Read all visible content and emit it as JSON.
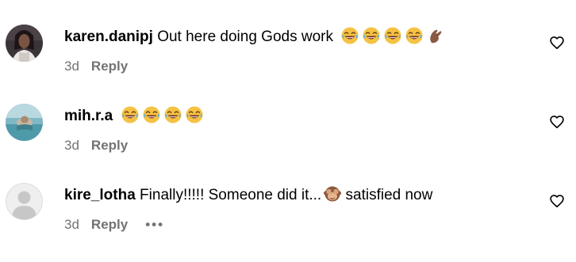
{
  "comments": [
    {
      "username": "karen.danipj",
      "text": "Out here doing Gods work",
      "emojis": [
        "joy-emoji",
        "joy-emoji",
        "joy-emoji",
        "joy-emoji",
        "pinching-hand-emoji"
      ],
      "time": "3d",
      "reply_label": "Reply"
    },
    {
      "username": "mih.r.a",
      "text": "",
      "emojis": [
        "joy-emoji",
        "joy-emoji",
        "joy-emoji",
        "joy-emoji"
      ],
      "time": "3d",
      "reply_label": "Reply"
    },
    {
      "username": "kire_lotha",
      "text_before": "Finally!!!!! Someone did it...",
      "text_after": " satisfied now",
      "emojis": [
        "see-no-evil-monkey-emoji"
      ],
      "time": "3d",
      "reply_label": "Reply",
      "more_label": "•••"
    }
  ],
  "colors": {
    "meta_gray": "#737373",
    "text": "#000000",
    "background": "#ffffff"
  }
}
